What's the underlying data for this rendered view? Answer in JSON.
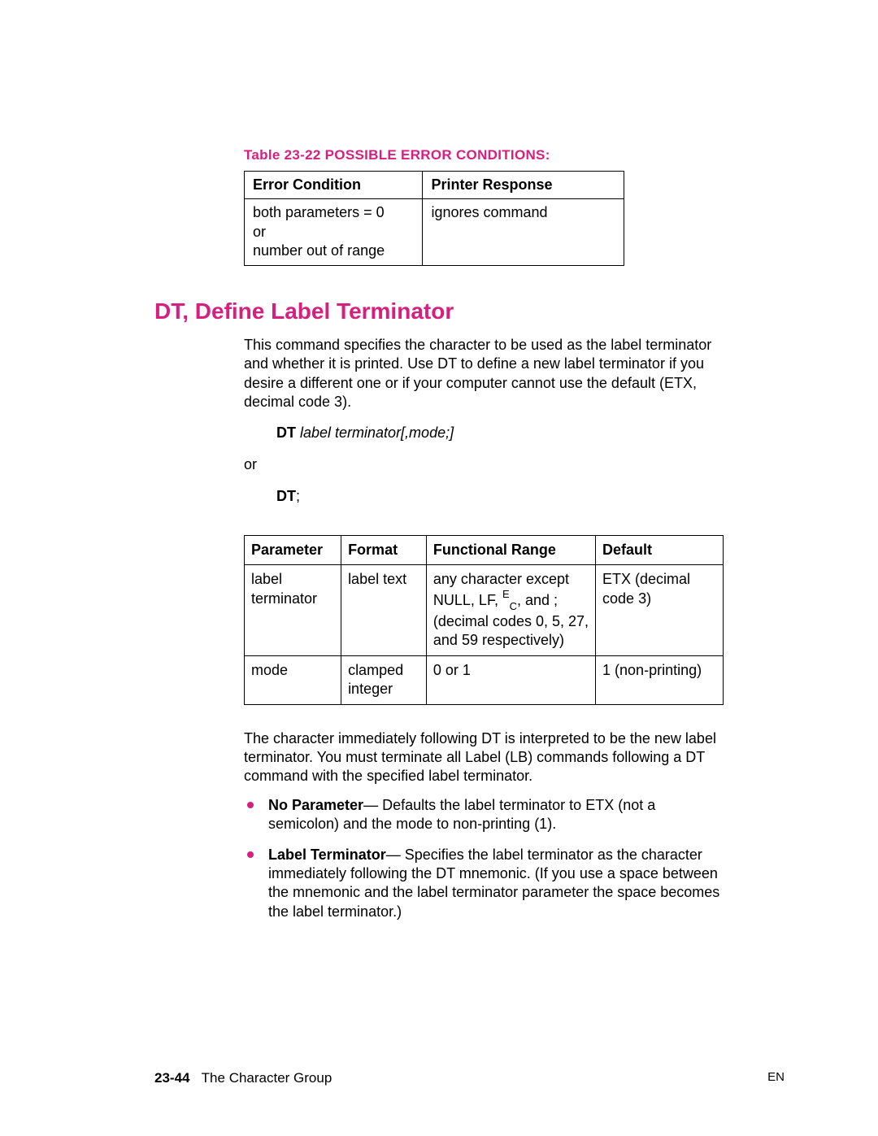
{
  "accent": "#d61f7f",
  "table1": {
    "caption": "Table 23-22  POSSIBLE ERROR CONDITIONS:",
    "headers": [
      "Error Condition",
      "Printer Response"
    ],
    "rows": [
      {
        "condition": "both parameters = 0\nor\nnumber out of range",
        "response": "ignores command"
      }
    ]
  },
  "section_title": "DT, Define Label Terminator",
  "intro_para": "This command specifies the character to be used as the label terminator and whether it is printed. Use DT to define a new label terminator if you desire a different one or if your computer cannot use the default (ETX, decimal code 3).",
  "syntax1_bold": "DT",
  "syntax1_italic": " label terminator[,mode;]",
  "or_text": "or",
  "syntax2_bold": "DT",
  "syntax2_tail": ";",
  "param_table": {
    "headers": [
      "Parameter",
      "Format",
      "Functional Range",
      "Default"
    ],
    "rows": [
      {
        "parameter": "label terminator",
        "format": "label text",
        "range_pre": "any character except NULL, LF, ",
        "range_escE": "E",
        "range_escC": "C",
        "range_post": ", and ; (decimal codes 0, 5, 27, and 59 respectively)",
        "default": "ETX (decimal code 3)"
      },
      {
        "parameter": "mode",
        "format": "clamped integer",
        "range": "0 or 1",
        "default": "1 (non-printing)"
      }
    ]
  },
  "body_para2": "The character immediately following DT is interpreted to be the new label terminator. You must terminate all Label (LB) commands following a DT command with the specified label terminator.",
  "bullets": [
    {
      "bold": "No Parameter",
      "text": "— Defaults the label terminator to ETX (not a semicolon) and the mode to non-printing (1)."
    },
    {
      "bold": "Label Terminator",
      "text": "— Specifies the label terminator as the character immediately following the DT mnemonic. (If you use a space between the mnemonic and the label terminator parameter the space becomes the label terminator.)"
    }
  ],
  "footer": {
    "page": "23-44",
    "title": "The Character Group",
    "right": "EN"
  }
}
